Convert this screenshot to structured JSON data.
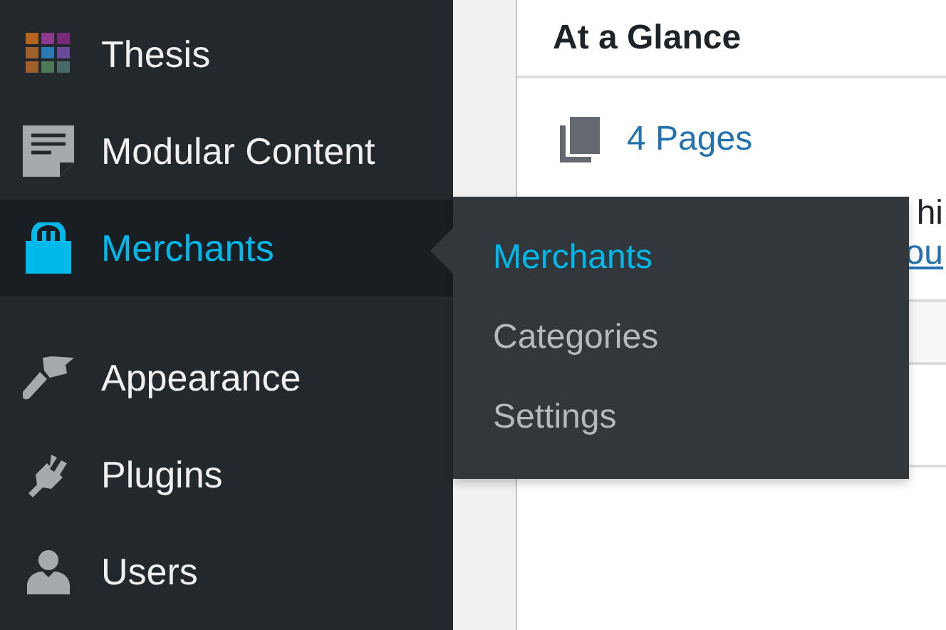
{
  "sidebar": {
    "items": [
      {
        "label": "Thesis",
        "selected": false
      },
      {
        "label": "Modular Content",
        "selected": false
      },
      {
        "label": "Merchants",
        "selected": true
      },
      {
        "label": "Appearance",
        "selected": false
      },
      {
        "label": "Plugins",
        "selected": false
      },
      {
        "label": "Users",
        "selected": false
      }
    ]
  },
  "flyout": {
    "items": [
      {
        "label": "Merchants",
        "selected": true
      },
      {
        "label": "Categories",
        "selected": false
      },
      {
        "label": "Settings",
        "selected": false
      }
    ]
  },
  "panel": {
    "title": "At a Glance",
    "pages_link": "4 Pages",
    "text_fragment": "hi",
    "link_fragment": "ou"
  }
}
